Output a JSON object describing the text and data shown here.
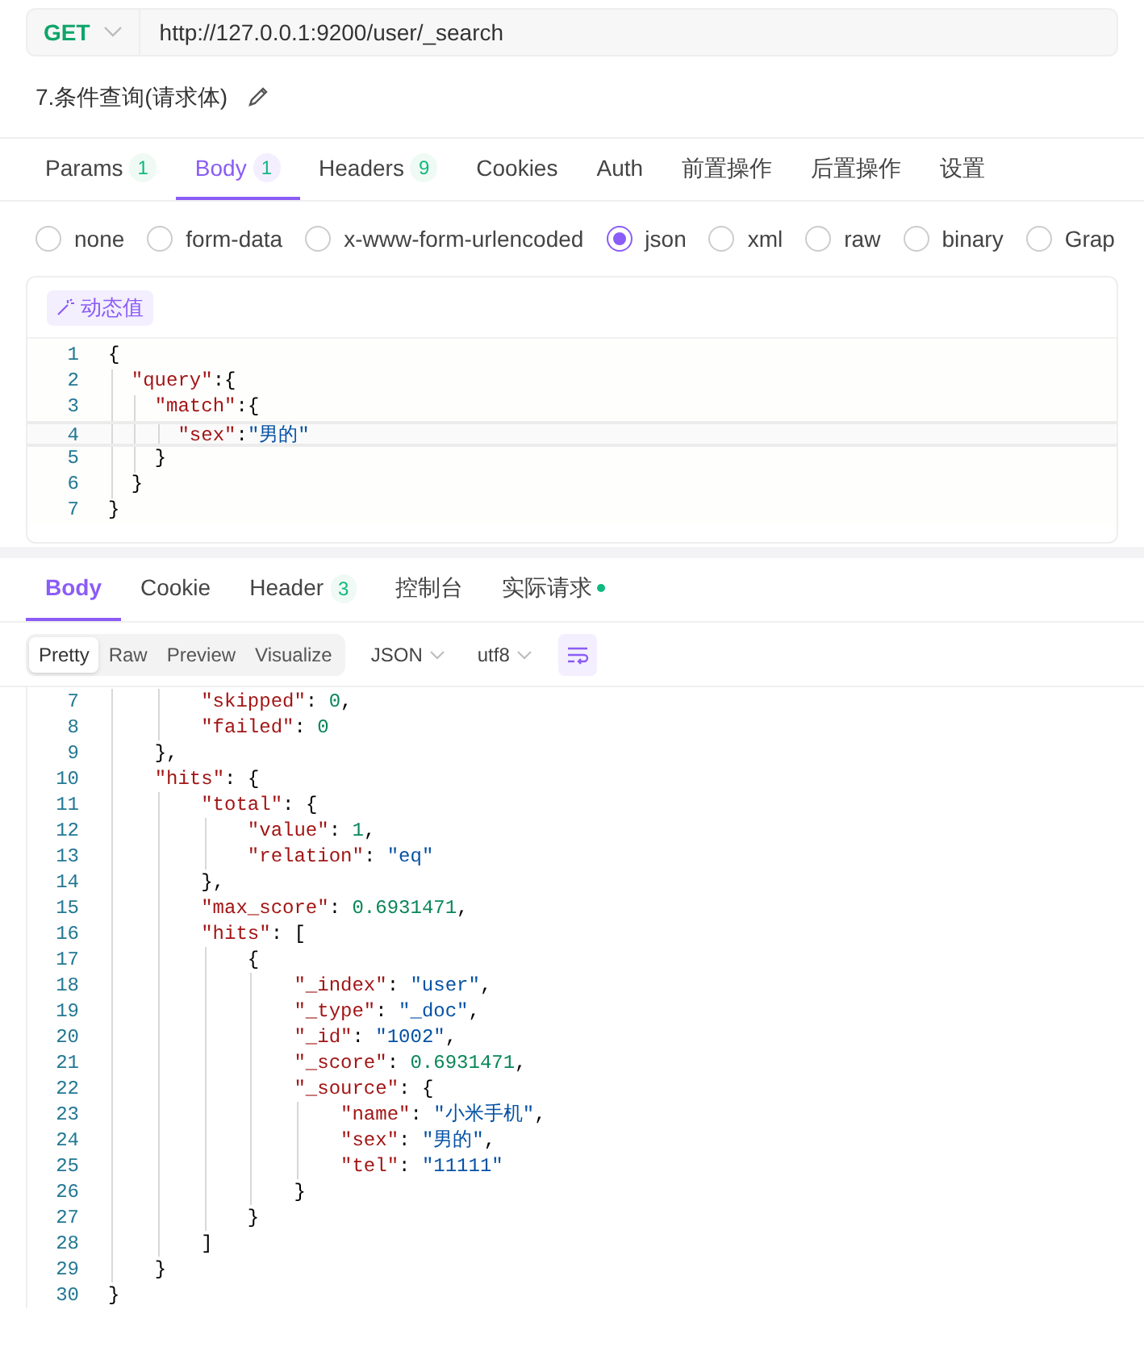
{
  "request": {
    "method": "GET",
    "url": "http://127.0.0.1:9200/user/_search",
    "name": "7.条件查询(请求体)"
  },
  "request_tabs": [
    {
      "label": "Params",
      "count": "1",
      "selected": false
    },
    {
      "label": "Body",
      "count": "1",
      "selected": true
    },
    {
      "label": "Headers",
      "count": "9",
      "selected": false
    },
    {
      "label": "Cookies",
      "selected": false
    },
    {
      "label": "Auth",
      "selected": false
    },
    {
      "label": "前置操作",
      "selected": false
    },
    {
      "label": "后置操作",
      "selected": false
    },
    {
      "label": "设置",
      "selected": false
    }
  ],
  "body_types": [
    {
      "label": "none",
      "selected": false
    },
    {
      "label": "form-data",
      "selected": false
    },
    {
      "label": "x-www-form-urlencoded",
      "selected": false
    },
    {
      "label": "json",
      "selected": true
    },
    {
      "label": "xml",
      "selected": false
    },
    {
      "label": "raw",
      "selected": false
    },
    {
      "label": "binary",
      "selected": false
    },
    {
      "label": "Grap",
      "selected": false
    }
  ],
  "dynamic_value_button": "动态值",
  "request_body": [
    {
      "number": "1",
      "code": "{",
      "current": false
    },
    {
      "number": "2",
      "code": "  \"query\":{",
      "current": false
    },
    {
      "number": "3",
      "code": "    \"match\":{",
      "current": false
    },
    {
      "number": "4",
      "code": "      \"sex\":\"男的\"",
      "current": true
    },
    {
      "number": "5",
      "code": "    }",
      "current": false
    },
    {
      "number": "6",
      "code": "  }",
      "current": false
    },
    {
      "number": "7",
      "code": "}",
      "current": false
    }
  ],
  "response_tabs": [
    {
      "label": "Body",
      "selected": true
    },
    {
      "label": "Cookie",
      "selected": false
    },
    {
      "label": "Header",
      "count": "3",
      "selected": false
    },
    {
      "label": "控制台",
      "selected": false
    },
    {
      "label": "实际请求",
      "dot": true,
      "selected": false
    }
  ],
  "view_modes": [
    {
      "label": "Pretty",
      "selected": true
    },
    {
      "label": "Raw",
      "selected": false
    },
    {
      "label": "Preview",
      "selected": false
    },
    {
      "label": "Visualize",
      "selected": false
    }
  ],
  "format_select": "JSON",
  "encoding_select": "utf8",
  "response_body": [
    {
      "number": "7",
      "code": "        \"skipped\": 0,"
    },
    {
      "number": "8",
      "code": "        \"failed\": 0"
    },
    {
      "number": "9",
      "code": "    },"
    },
    {
      "number": "10",
      "code": "    \"hits\": {"
    },
    {
      "number": "11",
      "code": "        \"total\": {"
    },
    {
      "number": "12",
      "code": "            \"value\": 1,"
    },
    {
      "number": "13",
      "code": "            \"relation\": \"eq\""
    },
    {
      "number": "14",
      "code": "        },"
    },
    {
      "number": "15",
      "code": "        \"max_score\": 0.6931471,"
    },
    {
      "number": "16",
      "code": "        \"hits\": ["
    },
    {
      "number": "17",
      "code": "            {"
    },
    {
      "number": "18",
      "code": "                \"_index\": \"user\","
    },
    {
      "number": "19",
      "code": "                \"_type\": \"_doc\","
    },
    {
      "number": "20",
      "code": "                \"_id\": \"1002\","
    },
    {
      "number": "21",
      "code": "                \"_score\": 0.6931471,"
    },
    {
      "number": "22",
      "code": "                \"_source\": {"
    },
    {
      "number": "23",
      "code": "                    \"name\": \"小米手机\","
    },
    {
      "number": "24",
      "code": "                    \"sex\": \"男的\","
    },
    {
      "number": "25",
      "code": "                    \"tel\": \"11111\""
    },
    {
      "number": "26",
      "code": "                }"
    },
    {
      "number": "27",
      "code": "            }"
    },
    {
      "number": "28",
      "code": "        ]"
    },
    {
      "number": "29",
      "code": "    }"
    },
    {
      "number": "30",
      "code": "}"
    }
  ]
}
